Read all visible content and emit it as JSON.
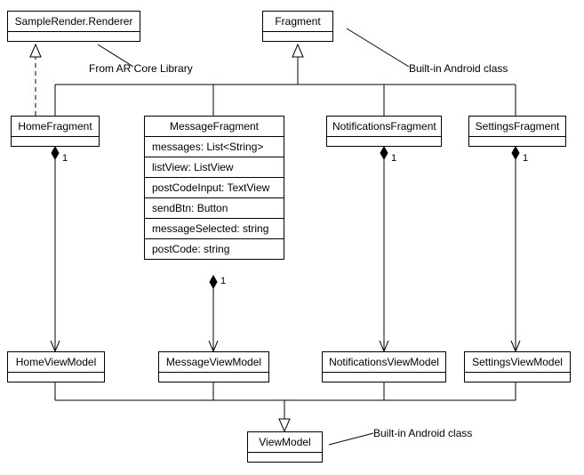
{
  "classes": {
    "sampleRender": {
      "name": "SampleRender.Renderer"
    },
    "fragment": {
      "name": "Fragment"
    },
    "homeFragment": {
      "name": "HomeFragment",
      "mult": "1"
    },
    "messageFragment": {
      "name": "MessageFragment",
      "attrs": [
        "messages: List<String>",
        "listView: ListView",
        "postCodeInput: TextView",
        "sendBtn: Button",
        "messageSelected: string",
        "postCode: string"
      ],
      "mult": "1"
    },
    "notificationsFragment": {
      "name": "NotificationsFragment",
      "mult": "1"
    },
    "settingsFragment": {
      "name": "SettingsFragment",
      "mult": "1"
    },
    "homeVM": {
      "name": "HomeViewModel"
    },
    "messageVM": {
      "name": "MessageViewModel"
    },
    "notificationsVM": {
      "name": "NotificationsViewModel"
    },
    "settingsVM": {
      "name": "SettingsViewModel"
    },
    "viewModel": {
      "name": "ViewModel"
    }
  },
  "notes": {
    "arCore": "From AR Core Library",
    "builtInFrag": "Built-in Android class",
    "builtInVM": "Built-in Android class"
  }
}
